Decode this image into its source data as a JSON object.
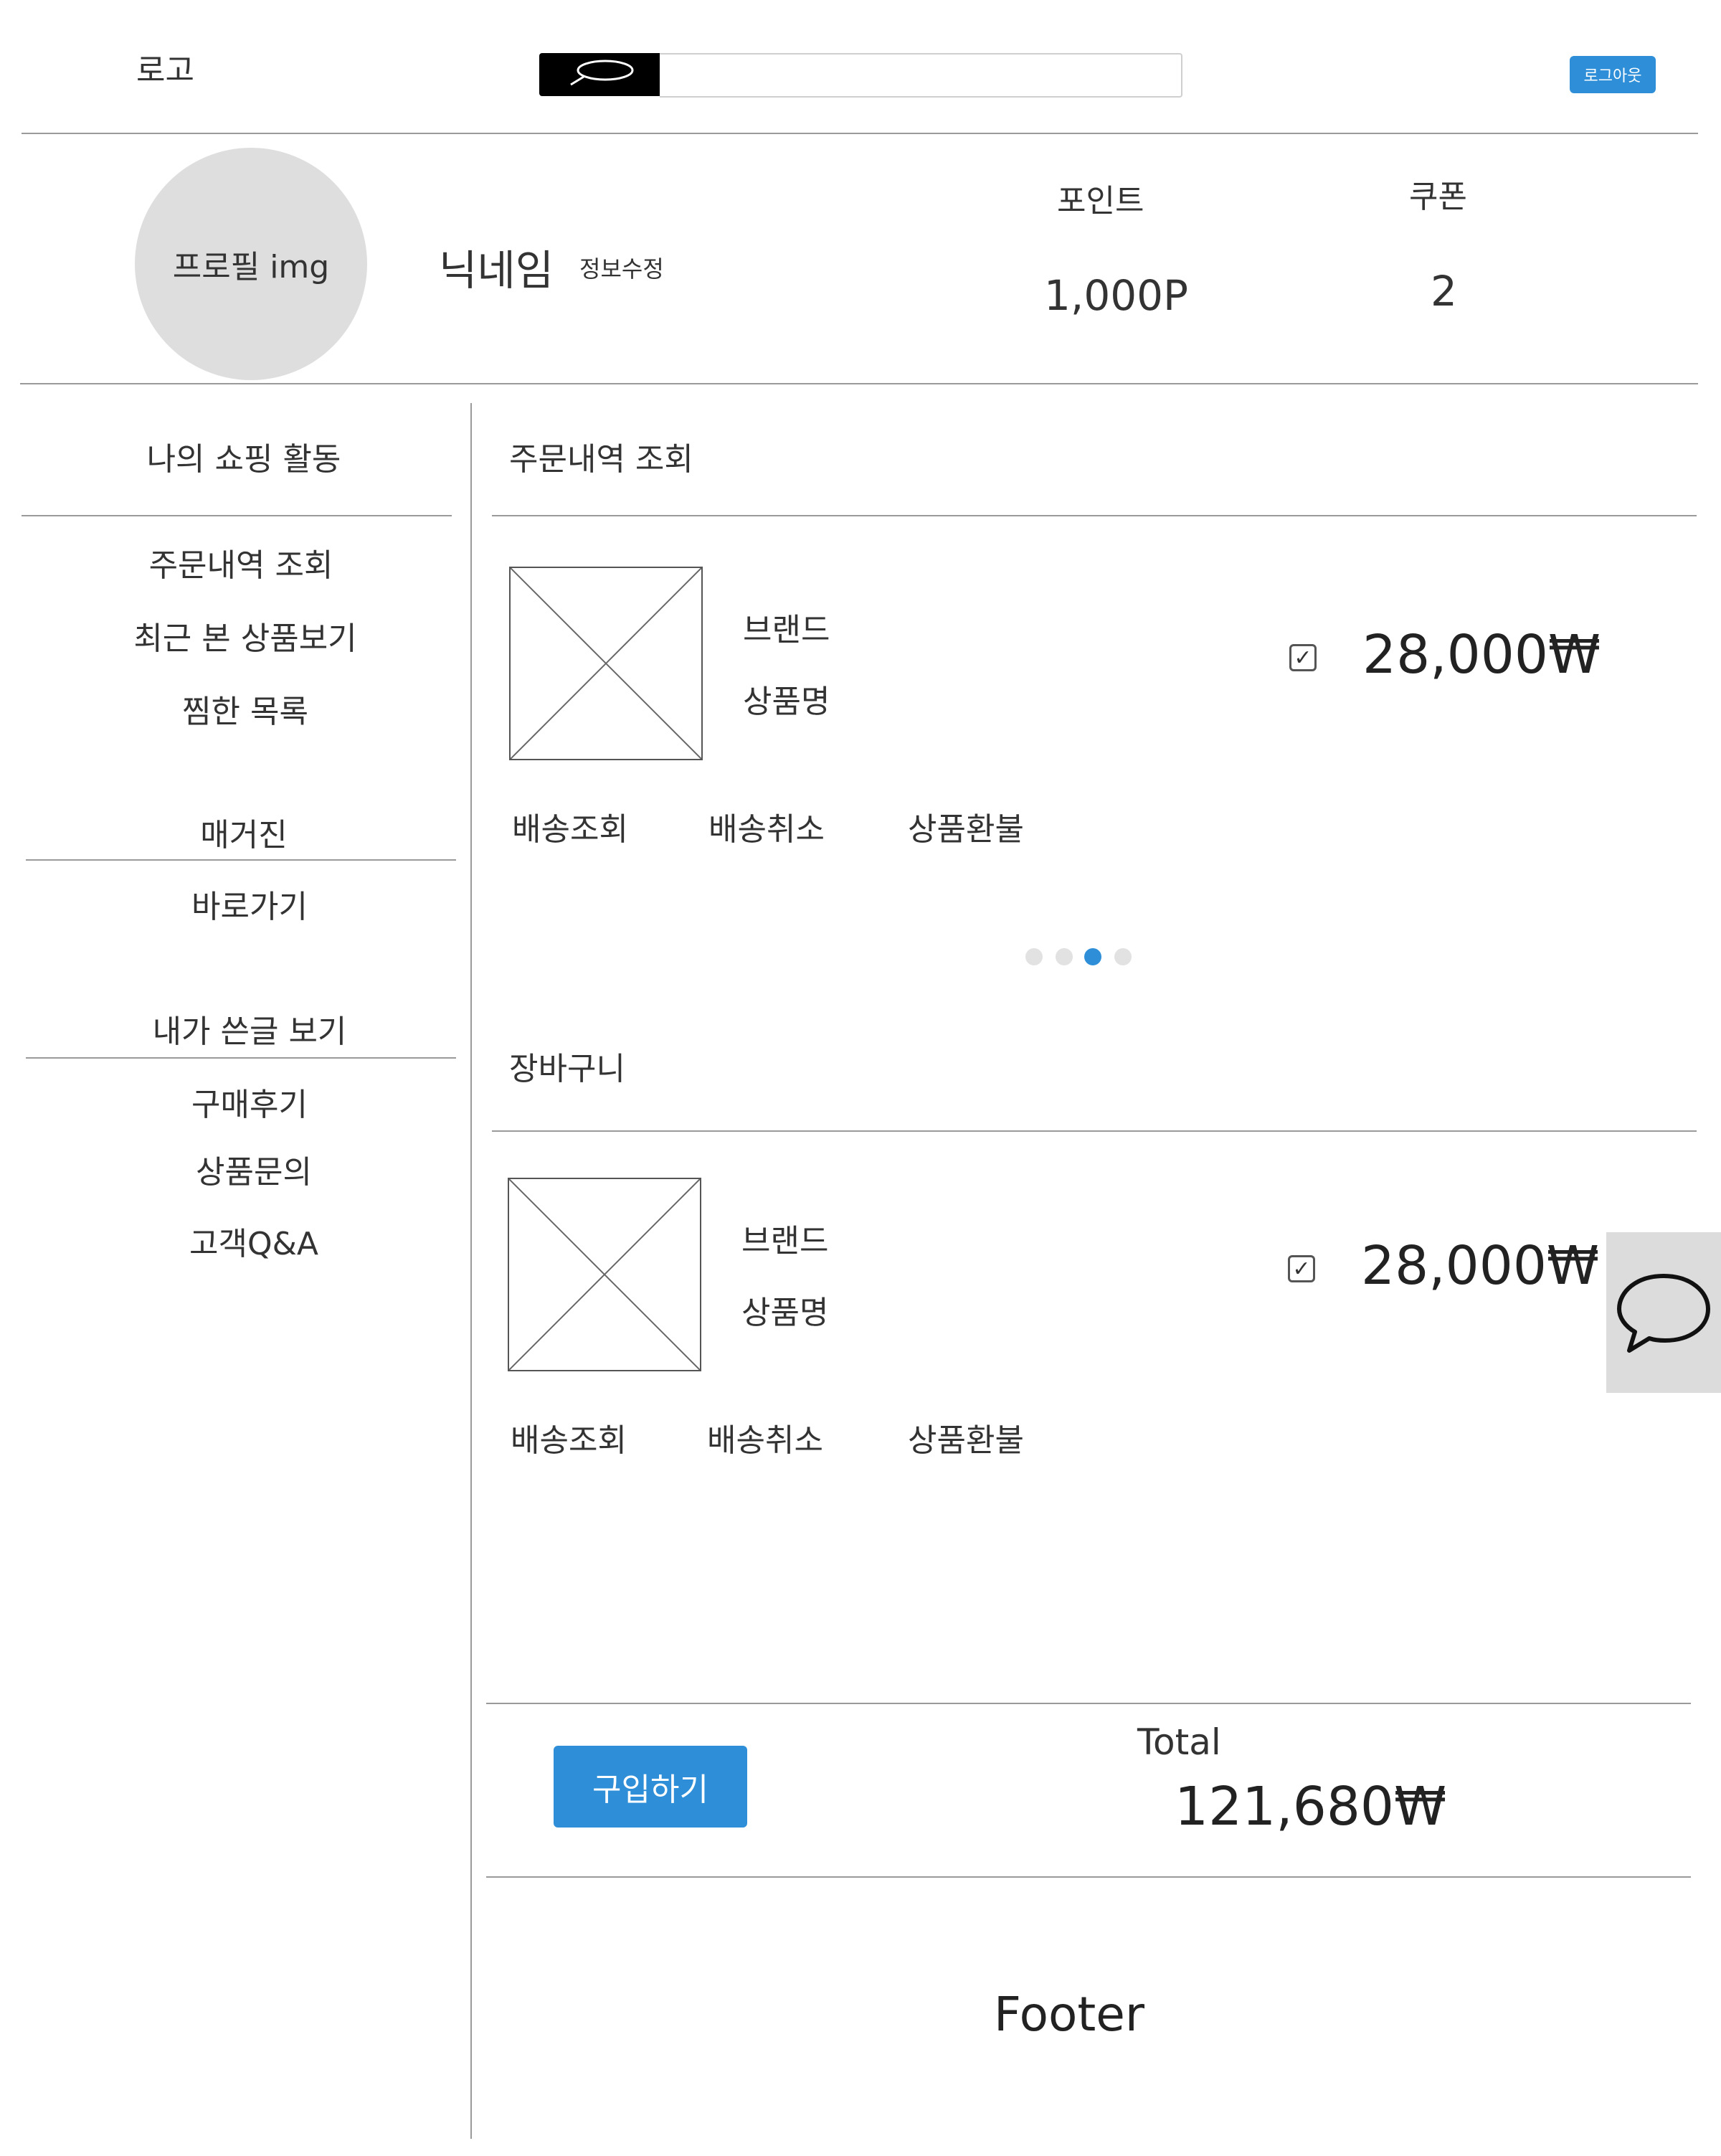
{
  "header": {
    "logo": "로고",
    "search_placeholder": "",
    "logout_label": "로그아웃"
  },
  "profile": {
    "avatar_label": "프로필 img",
    "nickname": "닉네임",
    "edit_label": "정보수정",
    "point_label": "포인트",
    "point_value": "1,000P",
    "coupon_label": "쿠폰",
    "coupon_value": "2"
  },
  "sidebar": {
    "shopping_heading": "나의 쇼핑 활동",
    "shopping_items": [
      "주문내역 조회",
      "최근 본 상품보기",
      "찜한 목록"
    ],
    "magazine_heading": "매거진",
    "magazine_items": [
      "바로가기"
    ],
    "posts_heading": "내가 쓴글 보기",
    "posts_items": [
      "구매후기",
      "상품문의",
      "고객Q&A"
    ]
  },
  "orders": {
    "title": "주문내역 조회",
    "item": {
      "brand": "브랜드",
      "name": "상품명",
      "price": "28,000₩",
      "checked": true,
      "actions": [
        "배송조회",
        "배송취소",
        "상품환불"
      ]
    },
    "carousel": {
      "count": 4,
      "active_index": 2
    }
  },
  "cart": {
    "title": "장바구니",
    "item": {
      "brand": "브랜드",
      "name": "상품명",
      "price": "28,000₩",
      "checked": true,
      "actions": [
        "배송조회",
        "배송취소",
        "상품환불"
      ]
    }
  },
  "checkout": {
    "buy_label": "구입하기",
    "total_label": "Total",
    "total_value": "121,680₩"
  },
  "footer": {
    "text": "Footer"
  },
  "colors": {
    "accent": "#2e8fd8",
    "placeholder_gray": "#dedede",
    "divider": "#9a9a9a"
  },
  "icons": {
    "search": "search-icon",
    "chat": "chat-bubble-icon",
    "checkbox": "checkbox-checked-icon"
  }
}
